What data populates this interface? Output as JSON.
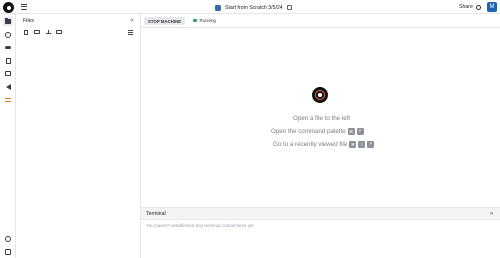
{
  "app": {
    "logo_icon": "jupyter-logo-icon",
    "menu_icon": "hamburger-menu-icon"
  },
  "header": {
    "notebook_title": "Start from Scratch 3/5/24",
    "notebook_icon": "notebook-icon",
    "edit_icon": "external-edit-icon",
    "share_label": "Share",
    "share_icon": "gear-icon",
    "avatar_initial": "M",
    "avatar_color": "#1d63b5"
  },
  "rail": {
    "items": [
      {
        "name": "files",
        "icon": "folder-icon",
        "active": true
      },
      {
        "name": "browser",
        "icon": "globe-icon",
        "active": false
      },
      {
        "name": "cloud",
        "icon": "cloud-icon",
        "active": false
      },
      {
        "name": "docs",
        "icon": "document-icon",
        "active": false
      },
      {
        "name": "data",
        "icon": "box-icon",
        "active": false
      },
      {
        "name": "vscode",
        "icon": "vscode-icon",
        "active": false
      },
      {
        "name": "git",
        "icon": "git-icon",
        "active": false
      }
    ],
    "bottom": [
      {
        "name": "help",
        "icon": "help-icon"
      },
      {
        "name": "settings",
        "icon": "settings-icon"
      }
    ]
  },
  "files": {
    "title": "Files",
    "close_label": "«"
  },
  "toolbar": {
    "stop_label": "STOP MACHINE",
    "status_text": "Running",
    "status_color": "#2e9c5a"
  },
  "main": {
    "hints": [
      {
        "text": "Open a file to the left",
        "keys": []
      },
      {
        "text": "Open the command palette",
        "keys": [
          "⌘",
          "P"
        ]
      },
      {
        "text": "Go to a recently viewed file",
        "keys": [
          "⌘",
          "⇧",
          "P"
        ]
      }
    ]
  },
  "terminal": {
    "title": "Terminal",
    "expand_label": "«",
    "message": "You haven't established any terminal connections yet"
  }
}
